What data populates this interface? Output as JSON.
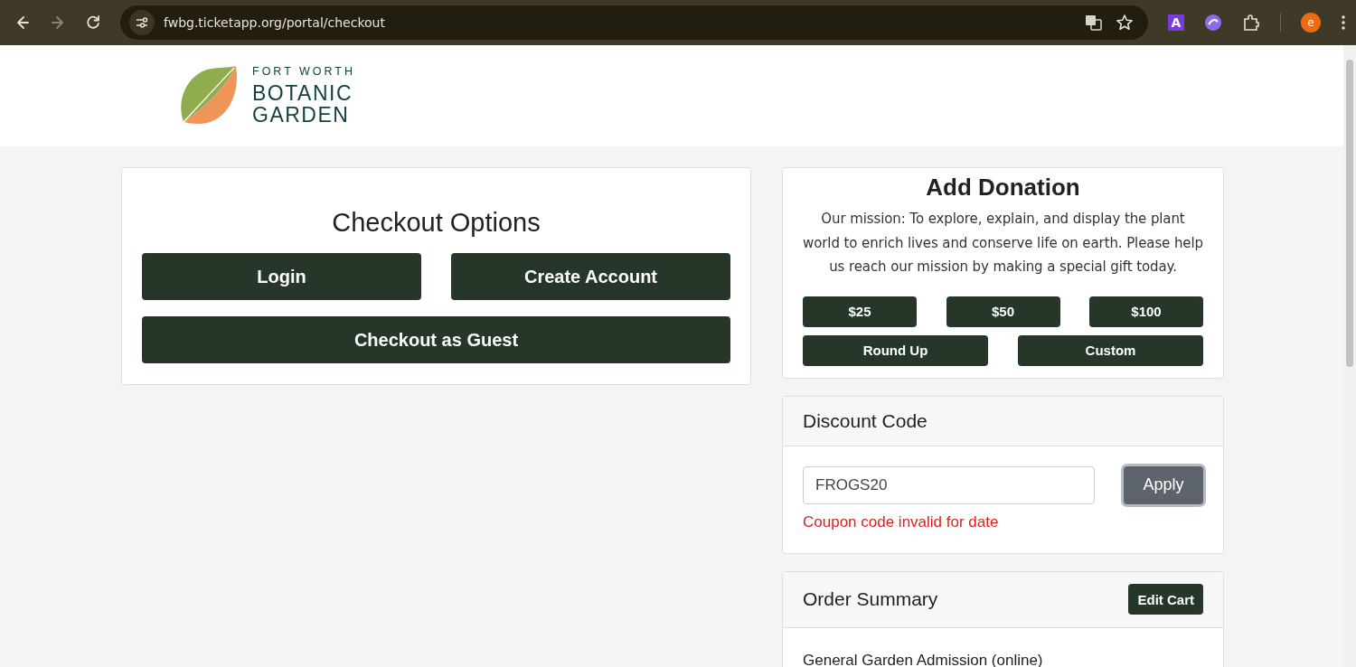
{
  "browser": {
    "nav": [
      {
        "kind": "back",
        "disabled": false
      },
      {
        "kind": "forward",
        "disabled": true
      },
      {
        "kind": "reload",
        "disabled": false
      }
    ],
    "url": "fwbg.ticketapp.org/portal/checkout",
    "extension_letter": "A",
    "profile_initial": "e"
  },
  "logo": {
    "lines": [
      "FORT WORTH",
      "BOTANIC",
      "GARDEN"
    ]
  },
  "checkout_options": {
    "title": "Checkout Options",
    "buttons": [
      "Login",
      "Create Account",
      "Checkout as Guest"
    ]
  },
  "donation": {
    "title": "Add Donation",
    "text": "Our mission: To explore, explain, and display the plant world to enrich lives and conserve life on earth. Please help us reach our mission by making a special gift today.",
    "amounts": [
      "$25",
      "$50",
      "$100"
    ],
    "other_buttons": [
      "Round Up",
      "Custom"
    ]
  },
  "discount": {
    "title": "Discount Code",
    "value": "FROGS20",
    "button": {
      "label": "Apply",
      "focused": true
    },
    "error": "Coupon code invalid for date"
  },
  "order_summary": {
    "title": "Order Summary",
    "button": "Edit Cart",
    "items": [
      "General Garden Admission (online)"
    ]
  }
}
